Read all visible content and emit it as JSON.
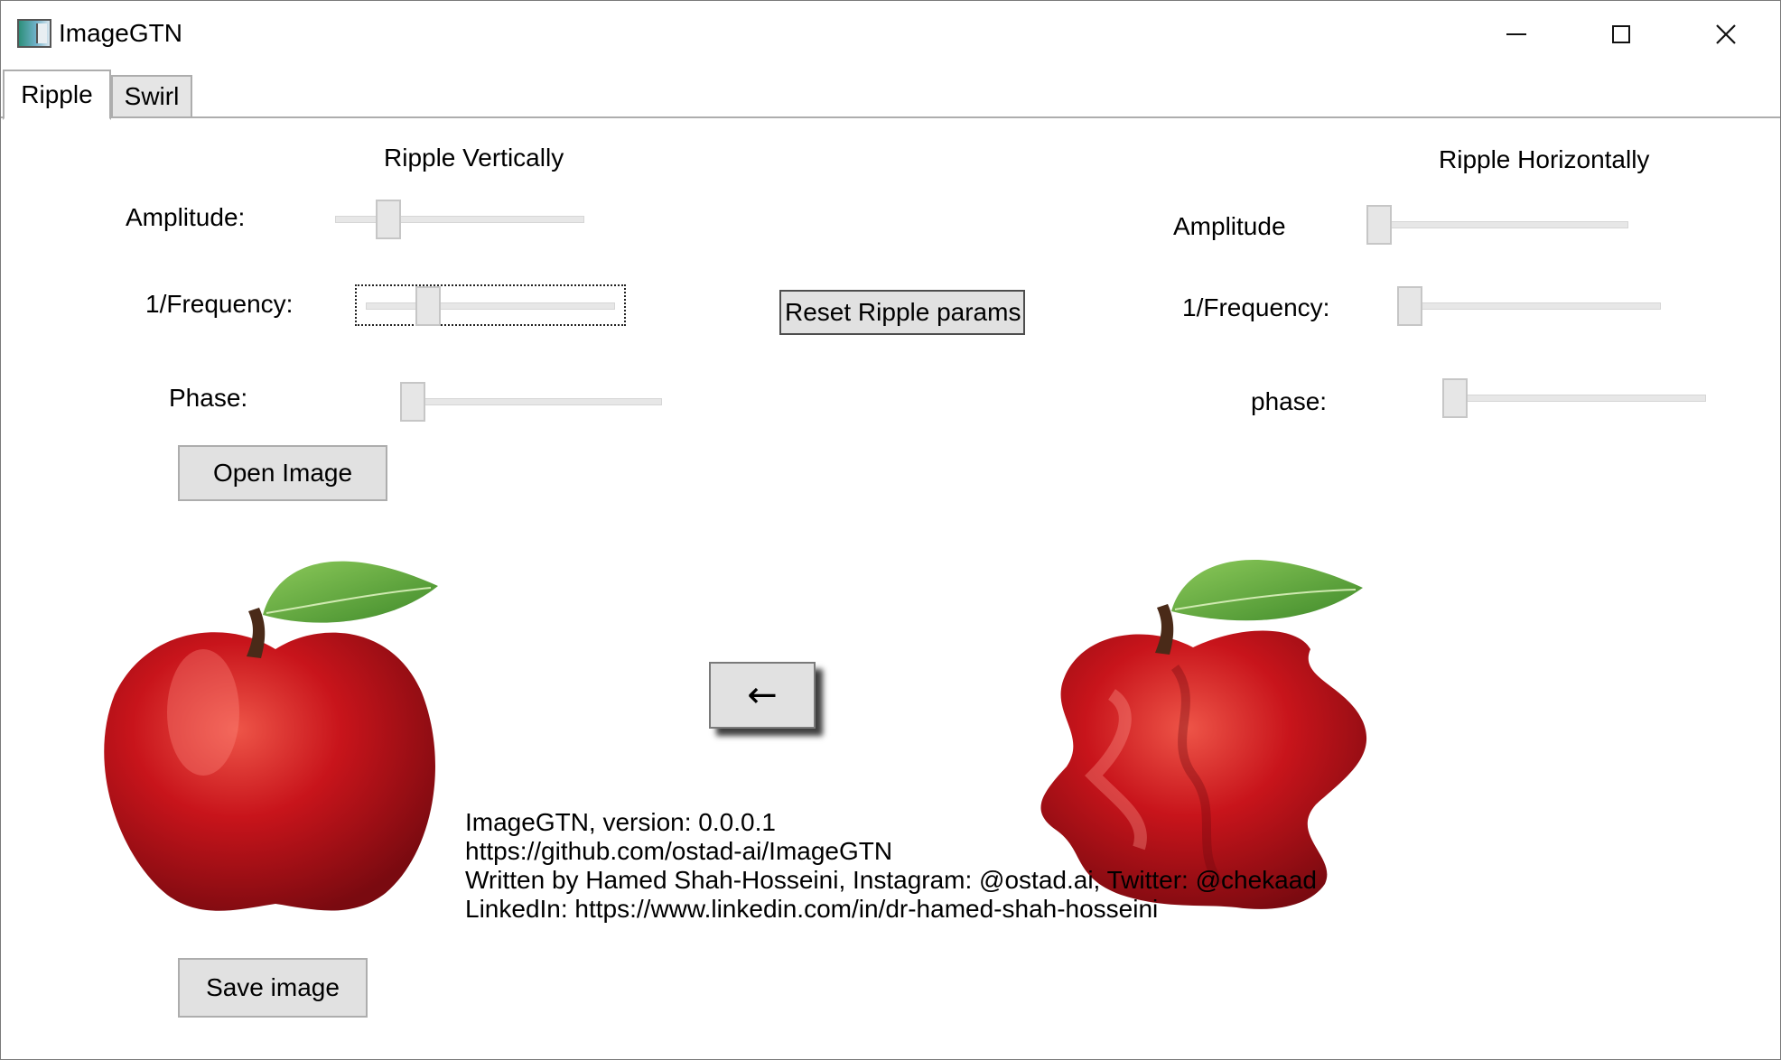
{
  "window": {
    "title": "ImageGTN",
    "controls": {
      "minimize": "—",
      "maximize": "☐",
      "close": "✕"
    }
  },
  "tabs": [
    {
      "label": "Ripple",
      "active": true
    },
    {
      "label": "Swirl",
      "active": false
    }
  ],
  "ripple_vertical": {
    "title": "Ripple Vertically",
    "amplitude_label": "Amplitude:",
    "frequency_label": "1/Frequency:",
    "phase_label": "Phase:",
    "amplitude_value": 0.18,
    "frequency_value": 0.22,
    "phase_value": 0.0
  },
  "ripple_horizontal": {
    "title": "Ripple Horizontally",
    "amplitude_label": "Amplitude",
    "frequency_label": "1/Frequency:",
    "phase_label": "phase:",
    "amplitude_value": 0.0,
    "frequency_value": 0.0,
    "phase_value": 0.0
  },
  "buttons": {
    "reset": "Reset Ripple params",
    "open": "Open Image",
    "apply_arrow": "←",
    "save": "Save image"
  },
  "images": {
    "source": "apple-original",
    "result": "apple-rippled"
  },
  "info": {
    "version": "ImageGTN, version: 0.0.0.1",
    "repo": "https://github.com/ostad-ai/ImageGTN",
    "author": "Written by Hamed Shah-Hosseini, Instagram: @ostad.ai, Twitter: @chekaad",
    "linkedin": "LinkedIn: https://www.linkedin.com/in/dr-hamed-shah-hosseini"
  },
  "colors": {
    "button_face": "#e1e1e1",
    "button_border": "#adadad",
    "apple_red": "#c8141b",
    "leaf_green": "#4f9a35"
  }
}
